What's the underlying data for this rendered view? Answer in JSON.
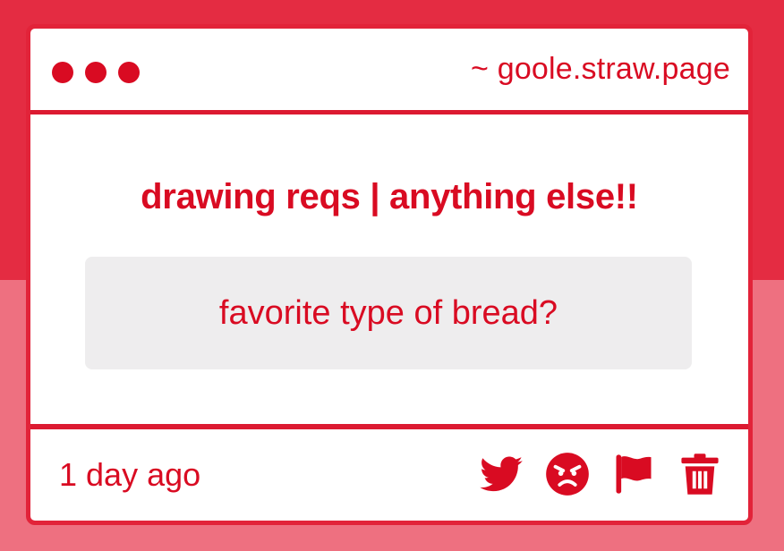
{
  "window": {
    "url": "~ goole.straw.page",
    "dots": [
      "dot-1",
      "dot-2",
      "dot-3"
    ]
  },
  "post": {
    "title": "drawing reqs | anything else!!",
    "question": "favorite type of bread?",
    "timestamp": "1 day ago"
  },
  "actions": [
    {
      "icon": "twitter-bird-icon"
    },
    {
      "icon": "angry-face-icon"
    },
    {
      "icon": "flag-icon"
    },
    {
      "icon": "trash-icon"
    }
  ],
  "colors": {
    "accent": "#d90b22",
    "background_top": "#e42c42",
    "background_bottom": "#ee7080",
    "box": "#eeedee"
  }
}
